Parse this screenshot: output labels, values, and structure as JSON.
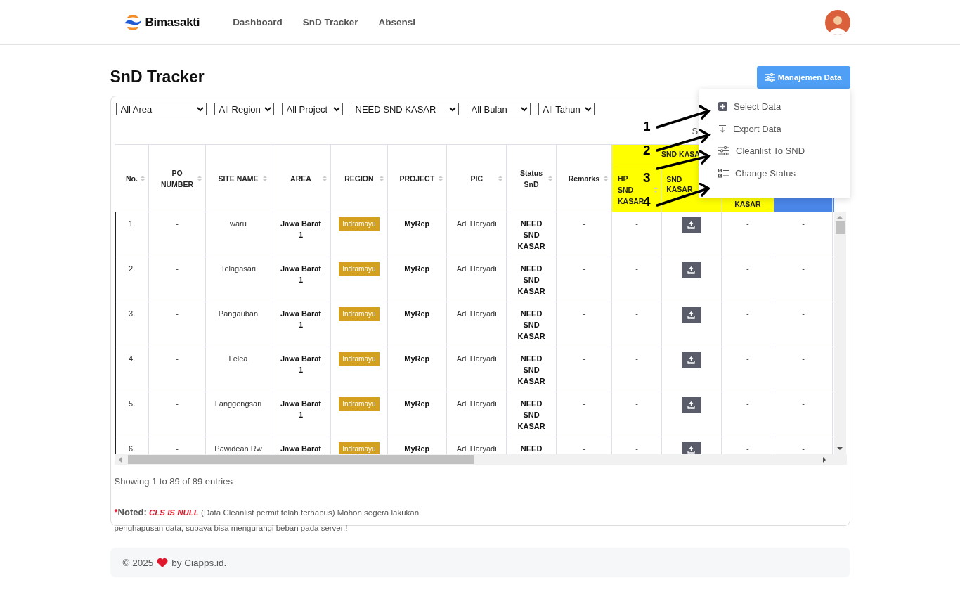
{
  "navbar": {
    "brand": "Bimasakti",
    "links": [
      "Dashboard",
      "SnD Tracker",
      "Absensi"
    ]
  },
  "page_title": "SnD Tracker",
  "manage_button": "Manajemen Data",
  "dropdown_menu": [
    {
      "label": "Select Data",
      "kind": "add"
    },
    {
      "label": "Export Data",
      "kind": "export"
    },
    {
      "label": "Cleanlist To SND",
      "kind": "sliders"
    },
    {
      "label": "Change Status",
      "kind": "checklist"
    }
  ],
  "filters": [
    "All Area",
    "All Region",
    "All Project",
    "NEED SND KASAR",
    "All Bulan",
    "All Tahun"
  ],
  "search_label": "S",
  "table": {
    "columns": [
      {
        "label": "No.",
        "sortable": true
      },
      {
        "label": "PO NUMBER",
        "sortable": true
      },
      {
        "label": "SITE NAME",
        "sortable": true
      },
      {
        "label": "AREA",
        "sortable": true
      },
      {
        "label": "REGION",
        "sortable": true
      },
      {
        "label": "PROJECT",
        "sortable": true
      },
      {
        "label": "PIC",
        "sortable": true
      },
      {
        "label": "Status SnD",
        "sortable": true
      },
      {
        "label": "Remarks",
        "sortable": true
      }
    ],
    "group": {
      "label": "SND KASA",
      "columns": [
        {
          "label": "HP SND KASAR",
          "sortable": true
        },
        {
          "label": "SND KASAR",
          "sortable": false
        },
        {
          "label": "KASAR",
          "sortable": false
        }
      ]
    },
    "rows": [
      {
        "no": "1.",
        "po_number": "-",
        "site_name": "waru",
        "area": "Jawa Barat 1",
        "region": "Indramayu",
        "project": "MyRep",
        "pic": "Adi Haryadi",
        "status": "NEED SND KASAR",
        "remarks": "-",
        "hp_snd_kasar": "-",
        "kasar": "-",
        "column_13": "-"
      },
      {
        "no": "2.",
        "po_number": "-",
        "site_name": "Telagasari",
        "area": "Jawa Barat 1",
        "region": "Indramayu",
        "project": "MyRep",
        "pic": "Adi Haryadi",
        "status": "NEED SND KASAR",
        "remarks": "-",
        "hp_snd_kasar": "-",
        "kasar": "-",
        "column_13": "-"
      },
      {
        "no": "3.",
        "po_number": "-",
        "site_name": "Pangauban",
        "area": "Jawa Barat 1",
        "region": "Indramayu",
        "project": "MyRep",
        "pic": "Adi Haryadi",
        "status": "NEED SND KASAR",
        "remarks": "-",
        "hp_snd_kasar": "-",
        "kasar": "-",
        "column_13": "-"
      },
      {
        "no": "4.",
        "po_number": "-",
        "site_name": "Lelea",
        "area": "Jawa Barat 1",
        "region": "Indramayu",
        "project": "MyRep",
        "pic": "Adi Haryadi",
        "status": "NEED SND KASAR",
        "remarks": "-",
        "hp_snd_kasar": "-",
        "kasar": "-",
        "column_13": "-"
      },
      {
        "no": "5.",
        "po_number": "-",
        "site_name": "Langgengsari",
        "area": "Jawa Barat 1",
        "region": "Indramayu",
        "project": "MyRep",
        "pic": "Adi Haryadi",
        "status": "NEED SND KASAR",
        "remarks": "-",
        "hp_snd_kasar": "-",
        "kasar": "-",
        "column_13": "-"
      },
      {
        "no": "6.",
        "po_number": "-",
        "site_name": "Pawidean Rw",
        "area": "Jawa Barat",
        "region": "Indramayu",
        "project": "MyRep",
        "pic": "Adi Haryadi",
        "status": "NEED",
        "remarks": "-",
        "hp_snd_kasar": "-",
        "kasar": "-",
        "column_13": "-"
      }
    ]
  },
  "annotations": [
    "1",
    "2",
    "3",
    "4"
  ],
  "entries_info": "Showing 1 to 89 of 89 entries",
  "note": {
    "marker": "*",
    "label": "Noted:",
    "highlight": "CLS IS NULL",
    "text": "(Data Cleanlist permit telah terhapus) Mohon segera lakukan penghapusan data, supaya bisa mengurangi beban pada server.!"
  },
  "footer": {
    "copyright": "© 2025",
    "credit": "by Ciapps.id."
  }
}
